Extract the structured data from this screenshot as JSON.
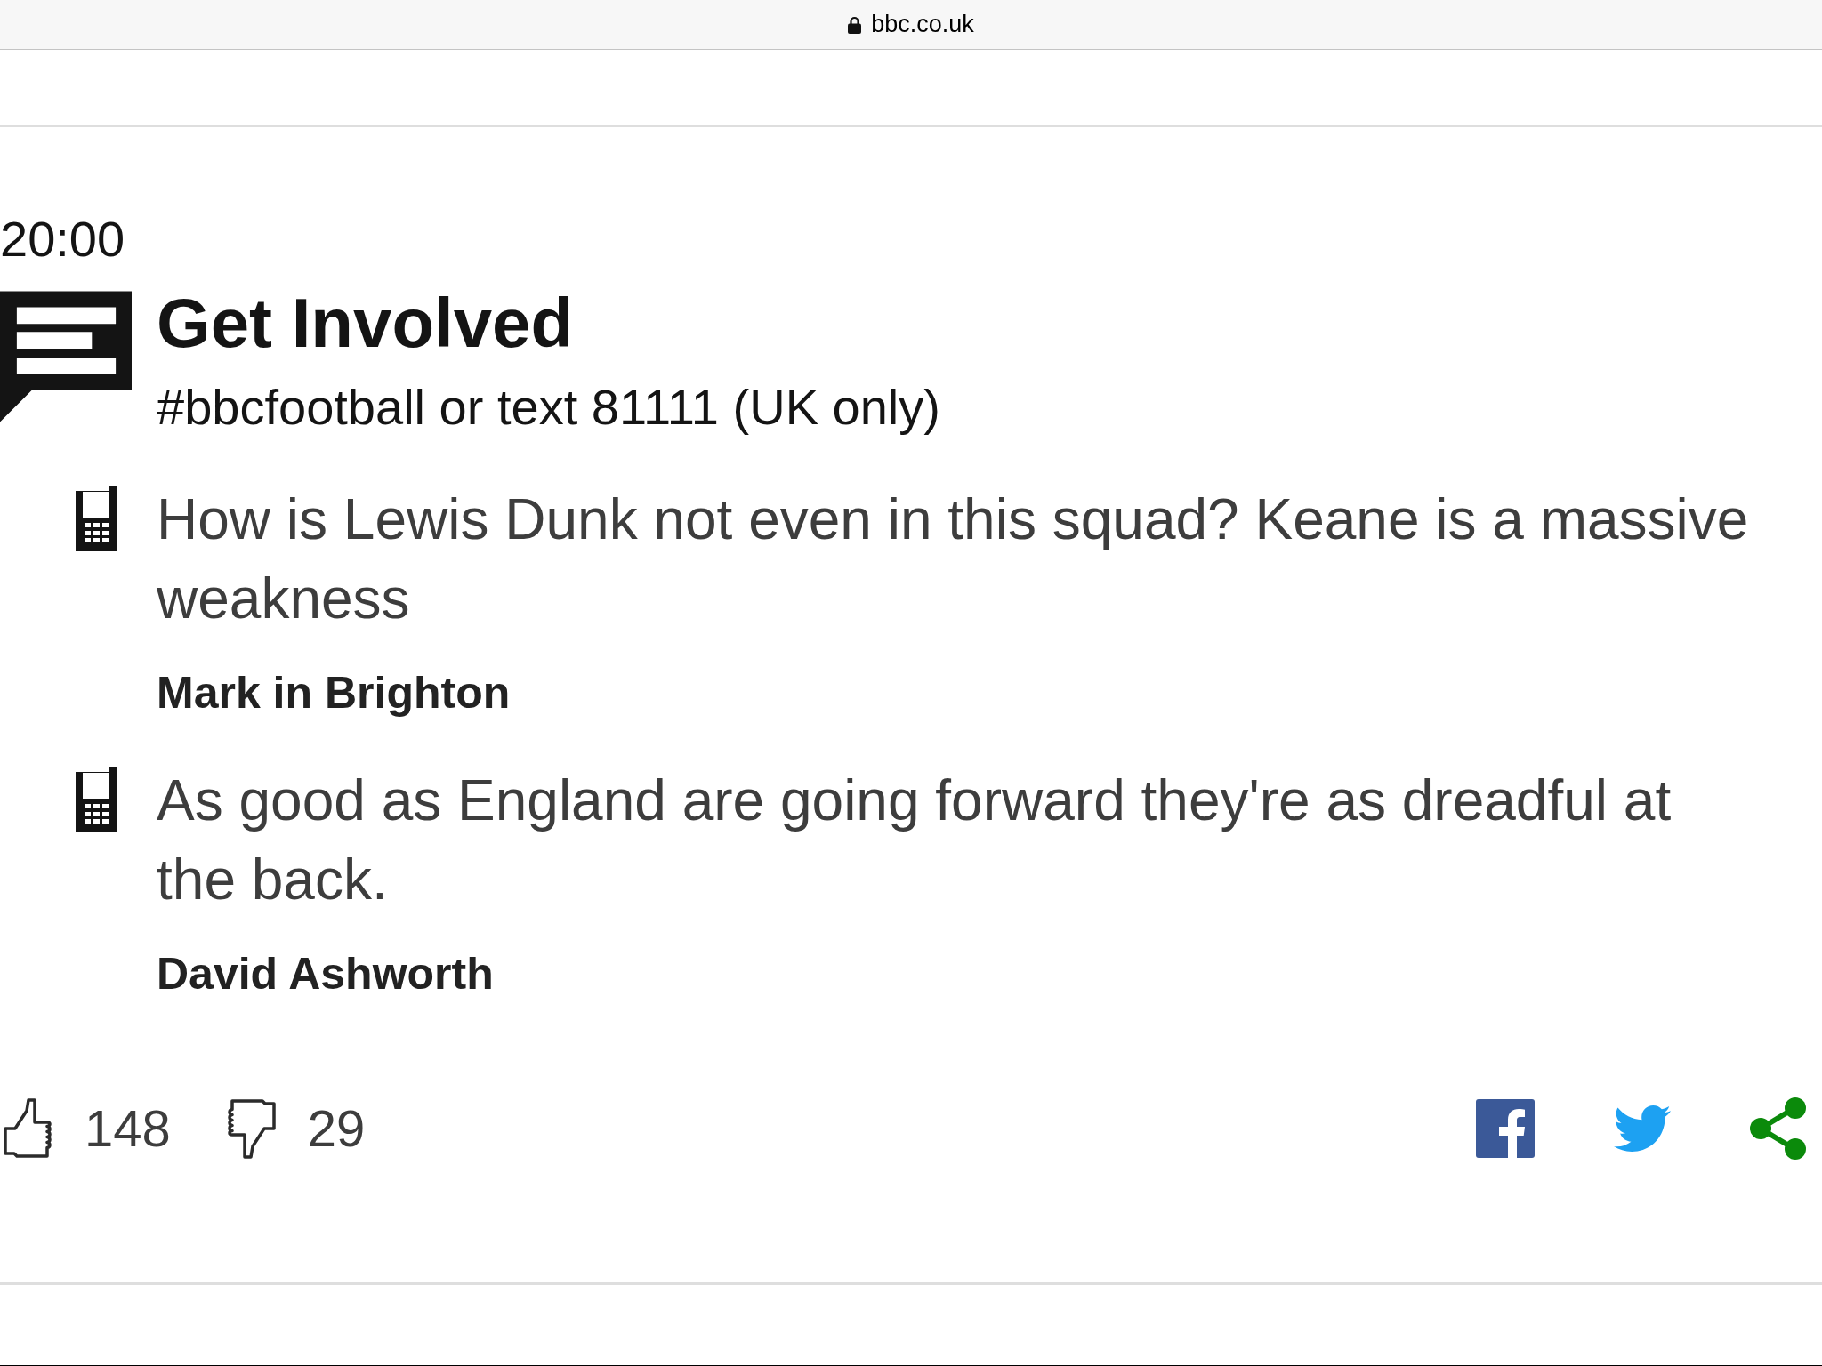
{
  "browser_bar": {
    "url": "bbc.co.uk"
  },
  "entry": {
    "time": "20:00",
    "title": "Get Involved",
    "subtitle": "#bbcfootball or text 81111 (UK only)",
    "comments": [
      {
        "text": "How is Lewis Dunk not even in this squad? Keane is a massive weakness",
        "author": "Mark in Brighton"
      },
      {
        "text": "As good as England are going forward they're as dreadful at the back.",
        "author": "David Ashworth"
      }
    ]
  },
  "reactions": {
    "likes": "148",
    "dislikes": "29"
  },
  "share": [
    {
      "kind": "facebook"
    },
    {
      "kind": "twitter"
    },
    {
      "kind": "share"
    }
  ]
}
